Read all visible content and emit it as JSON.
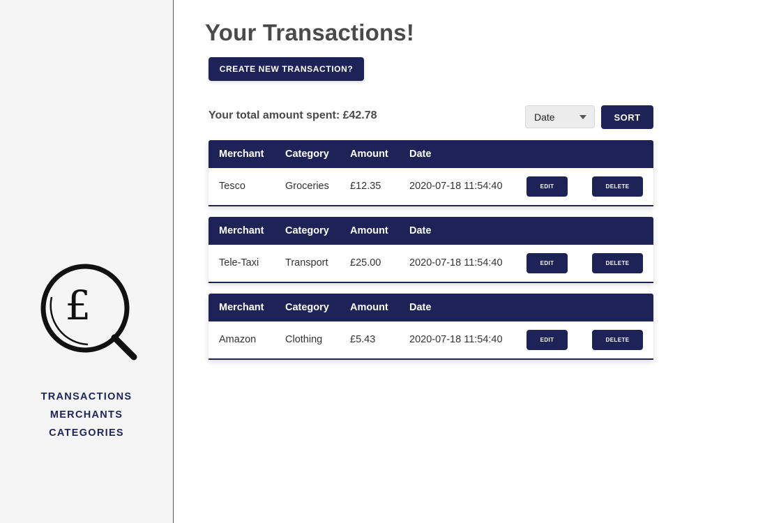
{
  "nav": {
    "items": [
      {
        "label": "TRANSACTIONS"
      },
      {
        "label": "MERCHANTS"
      },
      {
        "label": "CATEGORIES"
      }
    ]
  },
  "logo": {
    "icon": "pound-magnifier-icon",
    "symbol": "£"
  },
  "page": {
    "title": "Your Transactions!",
    "create_button": "CREATE NEW TRANSACTION?",
    "total_text": "Your total amount spent: £42.78"
  },
  "sort": {
    "selected": "Date",
    "button": "SORT"
  },
  "table": {
    "headers": {
      "merchant": "Merchant",
      "category": "Category",
      "amount": "Amount",
      "date": "Date"
    },
    "edit_label": "EDIT",
    "delete_label": "DELETE"
  },
  "transactions": [
    {
      "merchant": "Tesco",
      "category": "Groceries",
      "amount": "£12.35",
      "date": "2020-07-18 11:54:40"
    },
    {
      "merchant": "Tele-Taxi",
      "category": "Transport",
      "amount": "£25.00",
      "date": "2020-07-18 11:54:40"
    },
    {
      "merchant": "Amazon",
      "category": "Clothing",
      "amount": "£5.43",
      "date": "2020-07-18 11:54:40"
    }
  ],
  "colors": {
    "accent": "#1d2357",
    "sidebar_bg": "#f5f5f5",
    "title": "#4a4a4a"
  }
}
